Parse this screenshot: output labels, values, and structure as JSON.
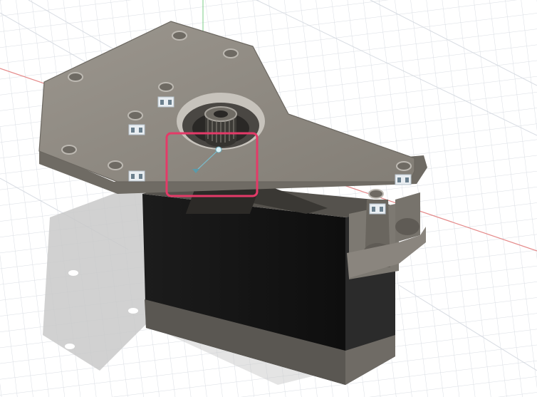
{
  "viewport": {
    "name": "3D CAD viewport",
    "background": "#ffffff",
    "grid_color": "#d7dbe2",
    "axis_x_color": "#e58a8a",
    "axis_y_color": "#7fd08a"
  },
  "model": {
    "plate_color": "#8f8a82",
    "plate_edge_color": "#6b6760",
    "body_color": "#161616",
    "body_band_color": "#5d5a55",
    "standoff_color": "#77736c"
  },
  "selection": {
    "color": "#e43a68"
  },
  "icons": [
    "joint-icon",
    "joint-icon",
    "joint-icon",
    "joint-icon",
    "joint-icon"
  ]
}
